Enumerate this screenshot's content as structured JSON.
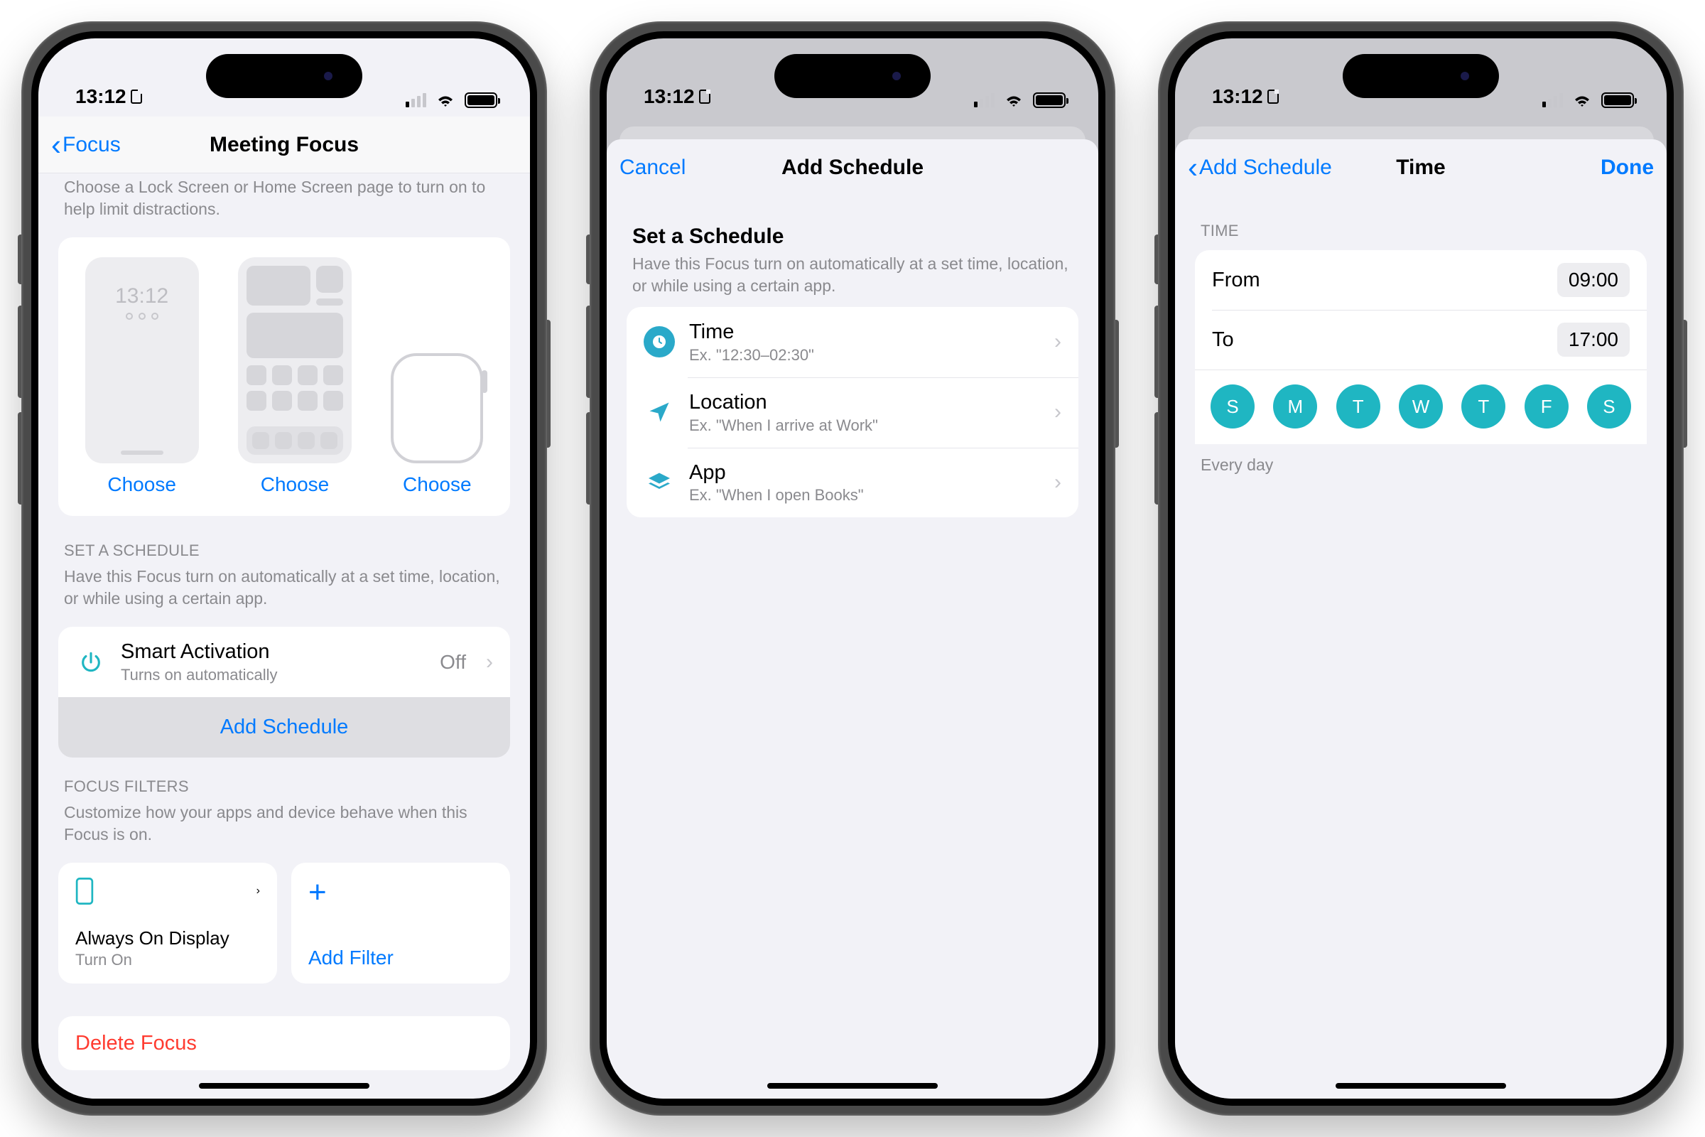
{
  "status": {
    "time": "13:12"
  },
  "screen1": {
    "back": "Focus",
    "title": "Meeting Focus",
    "customize_hint": "Choose a Lock Screen or Home Screen page to turn on to help limit distractions.",
    "lock_time": "13:12",
    "choose": "Choose",
    "schedule_header": "SET A SCHEDULE",
    "schedule_hint": "Have this Focus turn on automatically at a set time, location, or while using a certain app.",
    "smart": {
      "title": "Smart Activation",
      "sub": "Turns on automatically",
      "value": "Off"
    },
    "add_schedule": "Add Schedule",
    "filters_header": "FOCUS FILTERS",
    "filters_hint": "Customize how your apps and device behave when this Focus is on.",
    "filter1": {
      "title": "Always On Display",
      "sub": "Turn On"
    },
    "add_filter": "Add Filter",
    "delete": "Delete Focus"
  },
  "screen2": {
    "cancel": "Cancel",
    "title": "Add Schedule",
    "header": "Set a Schedule",
    "sub": "Have this Focus turn on automatically at a set time, location, or while using a certain app.",
    "rows": [
      {
        "title": "Time",
        "sub": "Ex. \"12:30–02:30\""
      },
      {
        "title": "Location",
        "sub": "Ex. \"When I arrive at Work\""
      },
      {
        "title": "App",
        "sub": "Ex. \"When I open Books\""
      }
    ]
  },
  "screen3": {
    "back": "Add Schedule",
    "title": "Time",
    "done": "Done",
    "header": "TIME",
    "from_label": "From",
    "from_value": "09:00",
    "to_label": "To",
    "to_value": "17:00",
    "days": [
      "S",
      "M",
      "T",
      "W",
      "T",
      "F",
      "S"
    ],
    "repeat": "Every day"
  }
}
